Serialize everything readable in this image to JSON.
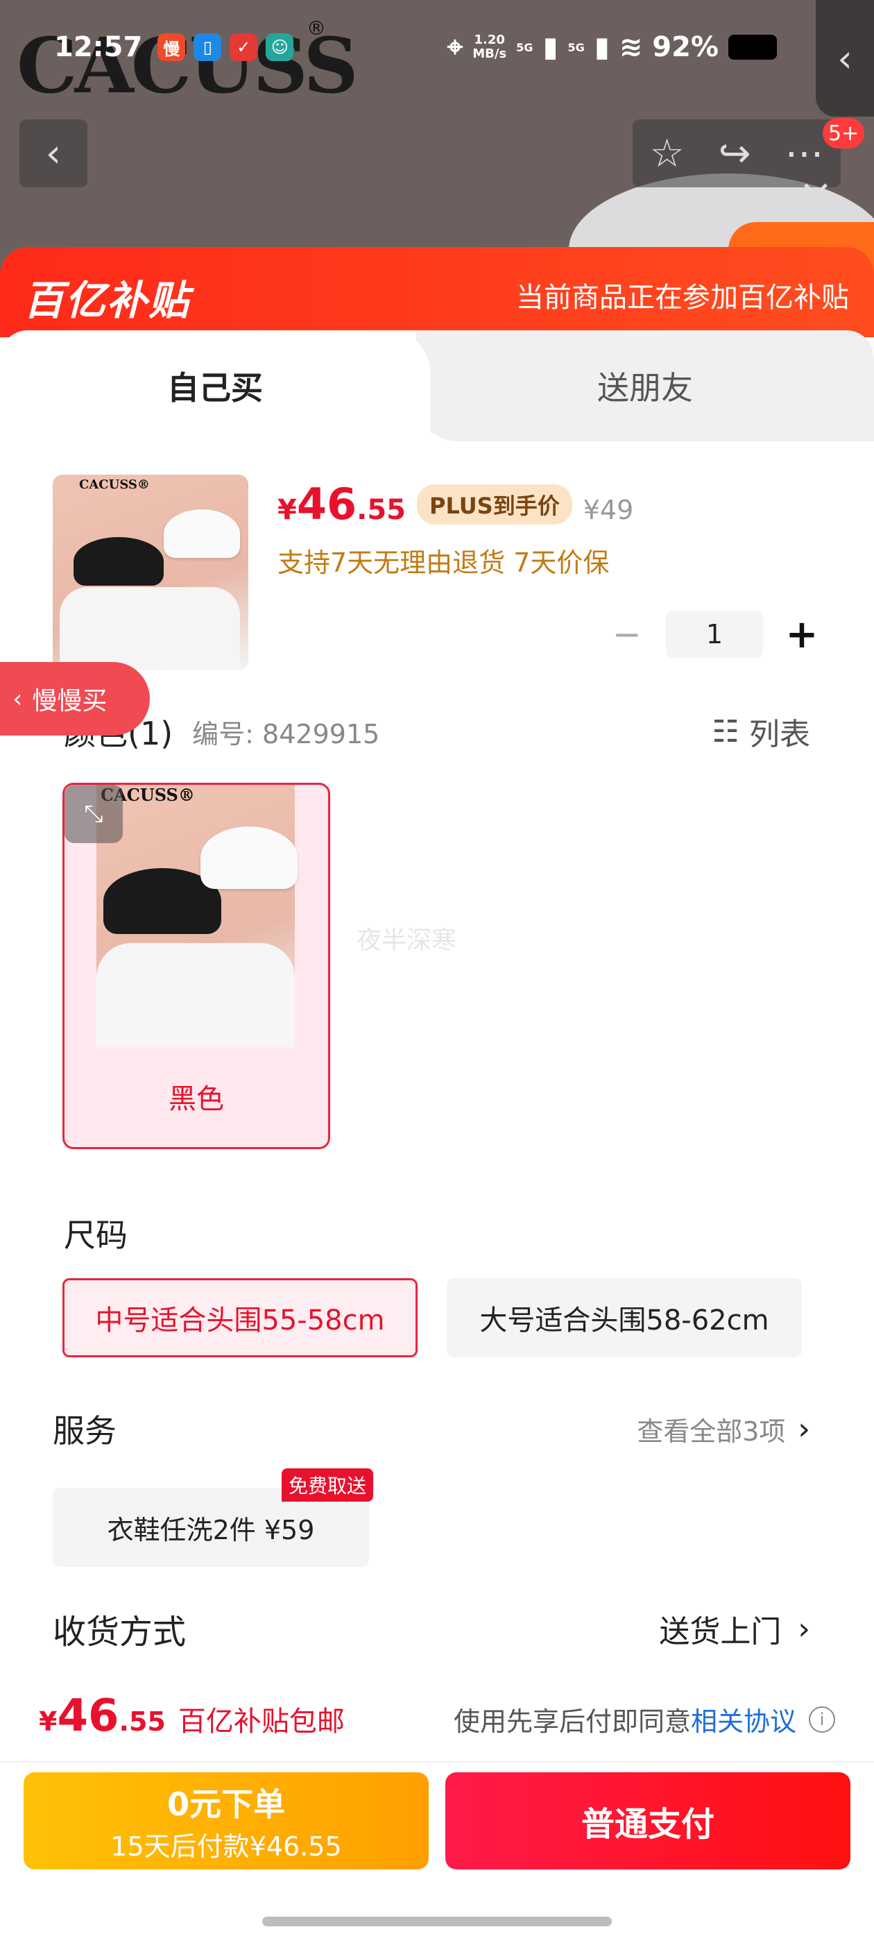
{
  "status_bar": {
    "time": "12:57",
    "app_icons": [
      {
        "icon": "app-slow-icon",
        "label": "慢",
        "color": "#f04a2a"
      },
      {
        "icon": "app-blue-icon",
        "label": "▯",
        "color": "#1e88e5"
      },
      {
        "icon": "app-red-icon",
        "label": "✓",
        "color": "#e53935"
      },
      {
        "icon": "app-avatar-icon",
        "label": "☺",
        "color": "#26a69a"
      }
    ],
    "net_speed_value": "1.20",
    "net_speed_unit": "MB/s",
    "sig1": "5G",
    "sig2": "5G",
    "battery": "92%"
  },
  "backdrop": {
    "brand": "CACUSS",
    "registered": "®"
  },
  "header_actions": {
    "badge": "5+"
  },
  "banner": {
    "logo": "百亿补贴",
    "tip": "当前商品正在参加百亿补贴"
  },
  "tabs": {
    "self": "自己买",
    "friend": "送朋友"
  },
  "product": {
    "thumb_brand": "CACUSS®",
    "currency": "¥",
    "price_int": "46",
    "price_dec": ".55",
    "plus_tag": "PLUS到手价",
    "original": "¥49",
    "perks": "支持7天无理由退货  7天价保",
    "quantity": "1",
    "minus": "−",
    "plus": "+"
  },
  "slow_buy": {
    "label": "慢慢买"
  },
  "color": {
    "title": "颜色(1)",
    "sku": "编号: 8429915",
    "list_label": "列表",
    "option": "黑色",
    "swatch_brand": "CACUSS®"
  },
  "watermark": "夜半深寒",
  "size": {
    "title": "尺码",
    "options": [
      "中号适合头围55-58cm",
      "大号适合头围58-62cm"
    ]
  },
  "service": {
    "title": "服务",
    "more": "查看全部3项",
    "chip": "衣鞋任洗2件  ¥59",
    "tag": "免费取送"
  },
  "shipping": {
    "title": "收货方式",
    "value": "送货上门"
  },
  "footer": {
    "currency": "¥",
    "price_int": "46",
    "price_dec": ".55",
    "free_ship": "百亿补贴包邮",
    "agree_text": "使用先享后付即同意",
    "agree_link": "相关协议",
    "zero_line1": "0元下单",
    "zero_line2": "15天后付款¥46.55",
    "pay_label": "普通支付"
  }
}
